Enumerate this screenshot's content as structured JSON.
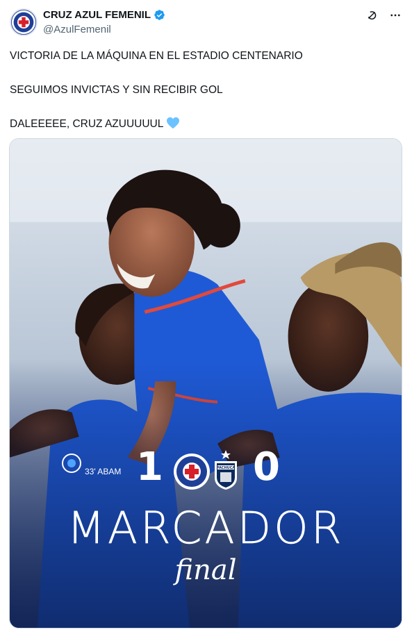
{
  "account": {
    "display_name": "CRUZ AZUL FEMENIL",
    "handle": "@AzulFemenil"
  },
  "tweet": {
    "line1": "VICTORIA DE LA MÁQUINA EN EL ESTADIO CENTENARIO",
    "line2": "SEGUIMOS INVICTAS Y SIN RECIBIR GOL",
    "line3": "DALEEEEE, CRUZ AZUUUUUL",
    "emoji": "light-blue-heart-icon"
  },
  "media": {
    "score_home": "1",
    "score_away": "0",
    "minute_text": "33' ABAM",
    "title": "MARCADOR",
    "subtitle": "final",
    "home_team": "Cruz Azul",
    "away_team": "PACHUCA"
  },
  "colors": {
    "text": "#0f1419",
    "secondary": "#536471",
    "verified": "#1d9bf0",
    "jersey_blue": "#1f5ad6",
    "heart": "#6cc2ff"
  }
}
